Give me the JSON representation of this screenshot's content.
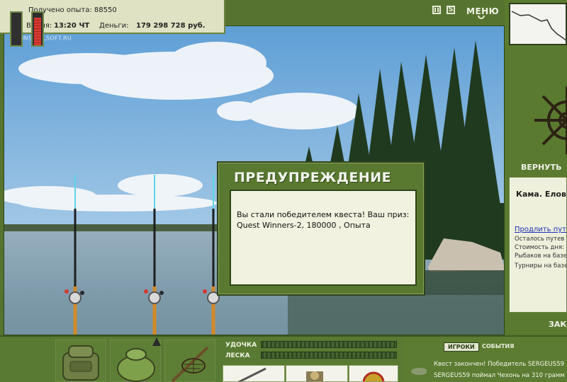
{
  "hud": {
    "xp_text": "Получено опыта: 88550",
    "time_label": "Время:",
    "time_value": "13:20 ЧТ",
    "money_label": "Деньги:",
    "money_value": "179 298 728 руб."
  },
  "watermark": "INSTALLSOFT.RU",
  "top_controls": {
    "sound_label": "S",
    "menu_label": "МЕНЮ"
  },
  "right_panel": {
    "return_label": "ВЕРНУТЬ",
    "location_title": "Кама. Елов",
    "extend_link": "Продлить путе",
    "rows": [
      "Осталось путев",
      "Стоимость дня:",
      "Рыбаков на базе",
      "Турниры на базе"
    ],
    "finish_label": "ЗАК"
  },
  "bottom": {
    "line1_label": "УДОЧКА",
    "line2_label": "ЛЕСКА",
    "meter_left_level": 0.0,
    "meter_right_level": 0.85
  },
  "chat": {
    "tab_players": "ИГРОКИ",
    "tab_events": "СОБЫТИЯ",
    "messages": [
      "Квест закончен! Победитель SERGEUS59",
      "SERGEUS59 поймал Чехонь на 310 грамм"
    ]
  },
  "dialog": {
    "title": "ПРЕДУПРЕЖДЕНИЕ",
    "message": "Вы стали победителем квеста! Ваш приз: Quest Winners-2, 180000 , Опыта"
  },
  "colors": {
    "panel_green": "#58792f",
    "hud_bg": "#dfe2c3",
    "link_blue": "#1c2fb6",
    "meter_red": "#d63a32"
  }
}
